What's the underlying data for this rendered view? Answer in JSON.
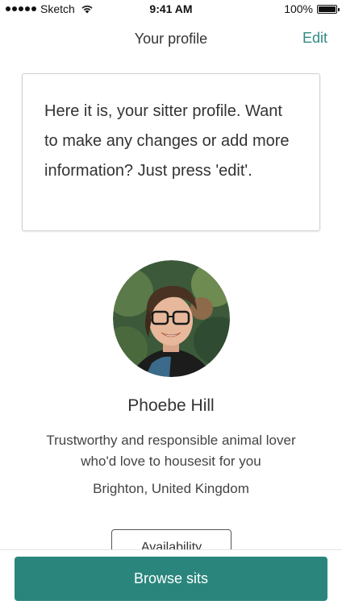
{
  "status_bar": {
    "carrier": "Sketch",
    "time": "9:41 AM",
    "battery_text": "100%",
    "signal_icon": "signal-dots-icon",
    "wifi_icon": "wifi-icon",
    "battery_icon": "battery-icon"
  },
  "nav": {
    "title": "Your profile",
    "edit_label": "Edit"
  },
  "info_card": {
    "text": "Here it is, your sitter profile. Want to make any changes or add more information? Just press 'edit'."
  },
  "profile": {
    "name": "Phoebe Hill",
    "bio": "Trustworthy and responsible animal lover who'd love to housesit for you",
    "location": "Brighton, United Kingdom",
    "availability_label": "Availability"
  },
  "footer": {
    "browse_label": "Browse sits"
  },
  "colors": {
    "accent": "#2f8b84",
    "button": "#2a867d"
  }
}
